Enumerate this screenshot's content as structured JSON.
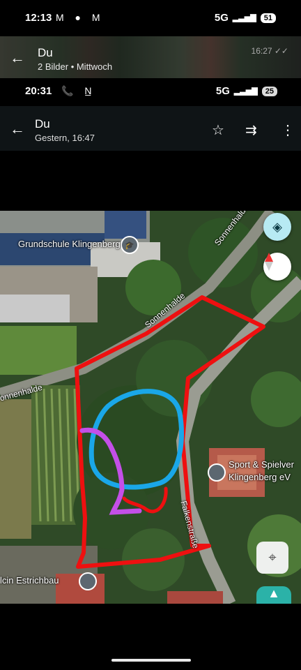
{
  "outer_status": {
    "time": "12:13",
    "left_icons": "M ● M",
    "network": "5G",
    "signal": "▂▃▅▇",
    "battery": "51"
  },
  "outer_header": {
    "back_icon": "arrow-left",
    "title": "Du",
    "subtitle": "2 Bilder • Mittwoch",
    "timestamp": "16:27 ✓✓",
    "bg_text": "lcin Estrichbau"
  },
  "inner_status": {
    "time": "20:31",
    "left_icons": "📞 N̲",
    "network": "5G",
    "signal": "▂▃▅▇",
    "battery": "25"
  },
  "inner_header": {
    "back_icon": "arrow-left",
    "title": "Du",
    "subtitle": "Gestern, 16:47",
    "star_icon": "☆",
    "forward_icon": "⇉",
    "menu_icon": "⋮"
  },
  "map": {
    "labels": {
      "school": "Grundschule Klingenberg",
      "street_top": "Sonnenhalde",
      "street_mid": "Sonnenhalde",
      "street_left": "onnenhalde",
      "sport_line1": "Sport & Spielver",
      "sport_line2": "Klingenberg eV",
      "street_right": "Falkenstraße",
      "business": "lcin Estrichbau"
    },
    "colors": {
      "outline": "#ee1010",
      "circle": "#1aa7e8",
      "line": "#c44fe8"
    }
  }
}
